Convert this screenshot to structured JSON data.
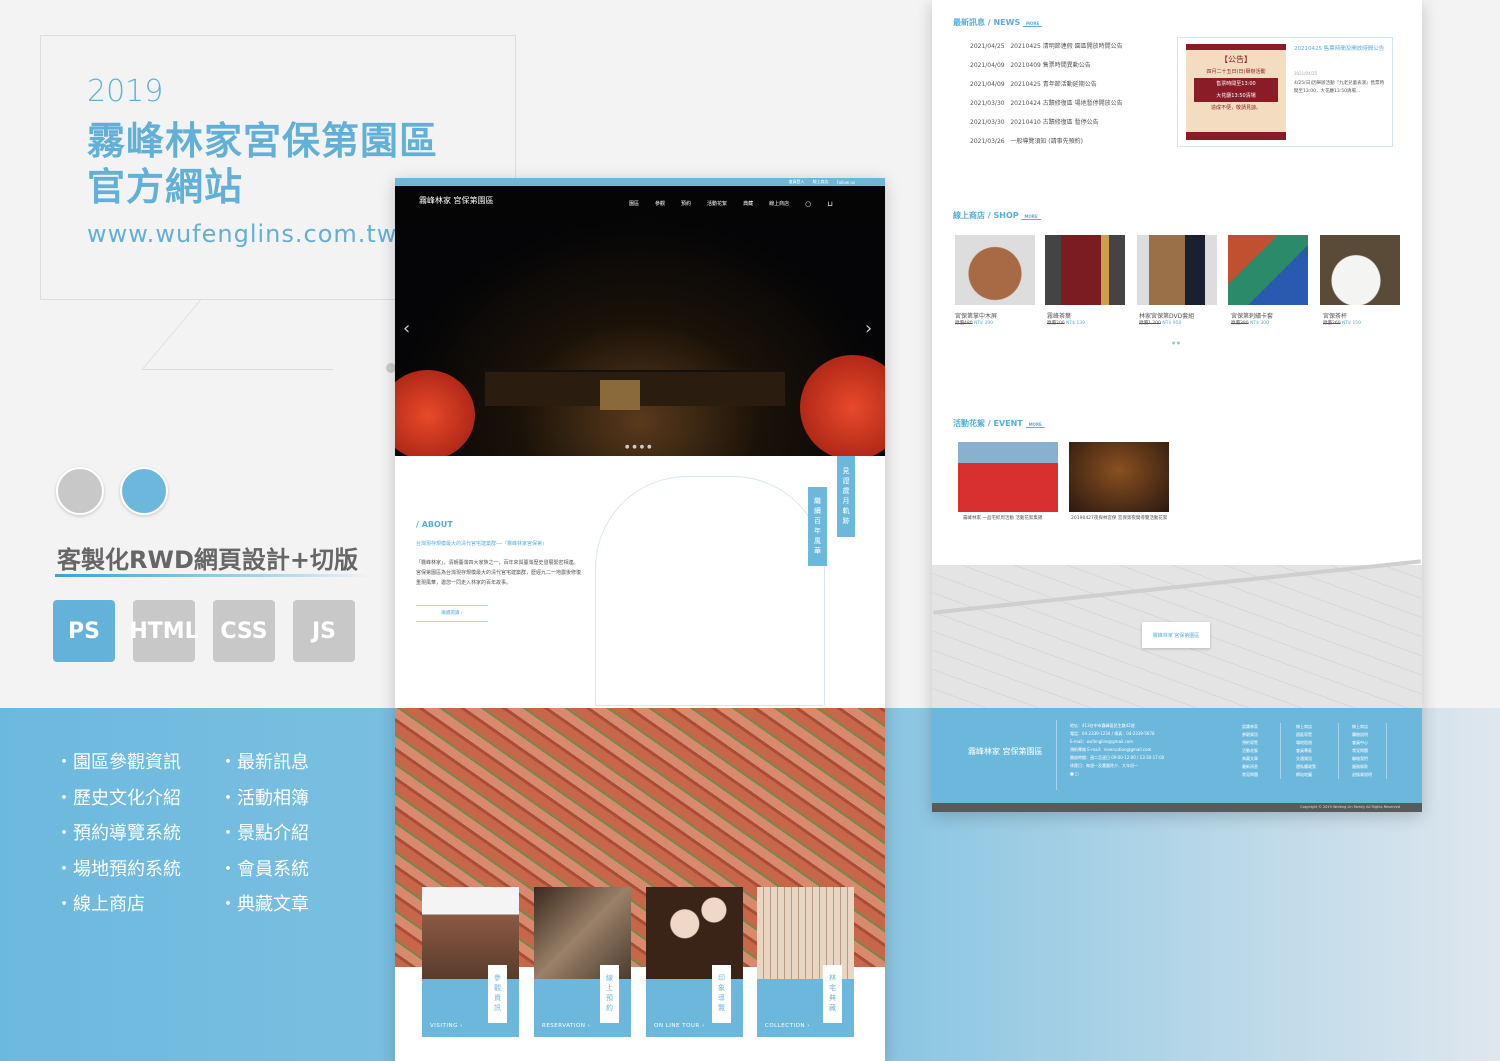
{
  "intro": {
    "year": "2019",
    "title_line1": "霧峰林家宮保第園區",
    "title_line2": "官方網站",
    "url": "www.wufenglins.com.tw"
  },
  "colors": {
    "accent": "#6cb8dc",
    "gray": "#c8c8c8"
  },
  "service": "客製化RWD網頁設計+切版",
  "tags": [
    "PS",
    "HTML",
    "CSS",
    "JS"
  ],
  "features_left": [
    "園區參觀資訊",
    "歷史文化介紹",
    "預約導覽系統",
    "場地預約系統",
    "線上商店"
  ],
  "features_right": [
    "最新訊息",
    "活動相簿",
    "景點介紹",
    "會員系統",
    "典藏文章"
  ],
  "site": {
    "logo": "霧峰林家 宮保第園區",
    "topbar": [
      "會員登入",
      "線上商店",
      "Follow us"
    ],
    "nav": [
      "園區",
      "參觀",
      "預約",
      "活動花絮",
      "典藏",
      "線上商店"
    ],
    "about": {
      "heading": "/ ABOUT",
      "subtitle": "台灣現存規模最大的清代官宅建築群──『霧峰林家宮保第』",
      "body": "「霧峰林家」，清朝臺灣四大家族之一，百年來與臺灣歷史發展緊密相連。宮保第園區為台灣現存規模最大的清代官宅建築群，歷經九二一地震後修復重現風華，邀您一同走入林家的百年故事。",
      "button": "繼續閱讀",
      "vertical": [
        "繼續百年風華",
        "見證歲月軌跡"
      ]
    },
    "cards": [
      {
        "zh": "參觀資訊",
        "en": "VISITING ›"
      },
      {
        "zh": "線上預約",
        "en": "RESERVATION ›"
      },
      {
        "zh": "印象導覽",
        "en": "ON LINE TOUR ›"
      },
      {
        "zh": "林宅典藏",
        "en": "COLLECTION ›"
      }
    ],
    "news": {
      "heading": "最新訊息 / NEWS",
      "more": "MORE",
      "items": [
        {
          "date": "2021/04/25",
          "title": "20210425 清明節連假 園區開放時間公告"
        },
        {
          "date": "2021/04/09",
          "title": "20210409 售票時間異動公告"
        },
        {
          "date": "2021/04/09",
          "title": "20210425 青年節活動延期公告"
        },
        {
          "date": "2021/03/30",
          "title": "20210424 古蹟修復區 場地暫停開放公告"
        },
        {
          "date": "2021/03/30",
          "title": "20210410 古蹟修復區 暫停公告"
        },
        {
          "date": "2021/03/26",
          "title": "一般導覽須知 (請事先預約)"
        }
      ],
      "featured": {
        "title": "20210425 售票時間及開放時間公告",
        "date": "2021/04/25",
        "excerpt": "4/25(日)因舉辦活動『九老兒童表演』售票時間至13:00，大花廳13:50清場...",
        "poster": [
          "【公告】",
          "四月二十五日(日)舉辦活動",
          "售票時間至13:00",
          "大花廳13:50清場",
          "造成不便，敬請見諒。"
        ]
      }
    },
    "shop": {
      "heading": "線上商店 / SHOP",
      "more": "MORE",
      "items": [
        {
          "name": "宮保第掌中木屏",
          "old": "原價480",
          "price": "NT$ 390"
        },
        {
          "name": "霧峰茶葉",
          "old": "原價200",
          "price": "NT$ 139"
        },
        {
          "name": "林家宮保第DVD套組",
          "old": "原價1,200",
          "price": "NT$ 950"
        },
        {
          "name": "宮保第刺繡卡套",
          "old": "原價380",
          "price": "NT$ 300"
        },
        {
          "name": "宮保茶杯",
          "old": "原價260",
          "price": "NT$ 150"
        }
      ]
    },
    "event": {
      "heading": "活動花絮 / EVENT",
      "more": "MORE",
      "items": [
        {
          "caption": "霧峰林家 一品宅抓周活動 活動花絮集錦"
        },
        {
          "caption": "20190427夜探林宮保 宮保第夜間導覽活動花絮"
        }
      ]
    },
    "map_label": "霧峰林家 宮保第園區",
    "footer": {
      "contact": [
        "地址：413台中市霧峰區民生路42號",
        "電話：04-2339-1234 / 傳真：04-2339-5678",
        "E-mail：wufenglins@gmail.com",
        "預約專線 E-mail：reservation@gmail.com",
        "開放時間：週二至週日 09:00-12:00 / 13:30-17:00",
        "休館日：每週一及農曆除夕、大年初一"
      ],
      "col1": [
        "認識林家",
        "參觀資訊",
        "預約導覽",
        "活動花絮",
        "典藏文章",
        "最新消息",
        "常見問題"
      ],
      "col2": [
        "線上商店",
        "園區導覽",
        "場地租借",
        "會員專區",
        "交通資訊",
        "隱私權政策",
        "網站地圖"
      ],
      "col3": [
        "線上商店",
        "購物說明",
        "會員中心",
        "常見問題",
        "聯絡我們",
        "服務條款",
        "退換貨說明"
      ],
      "copyright": "Copyright © 2019 Wufeng Lin Family All Rights Reserved"
    }
  }
}
